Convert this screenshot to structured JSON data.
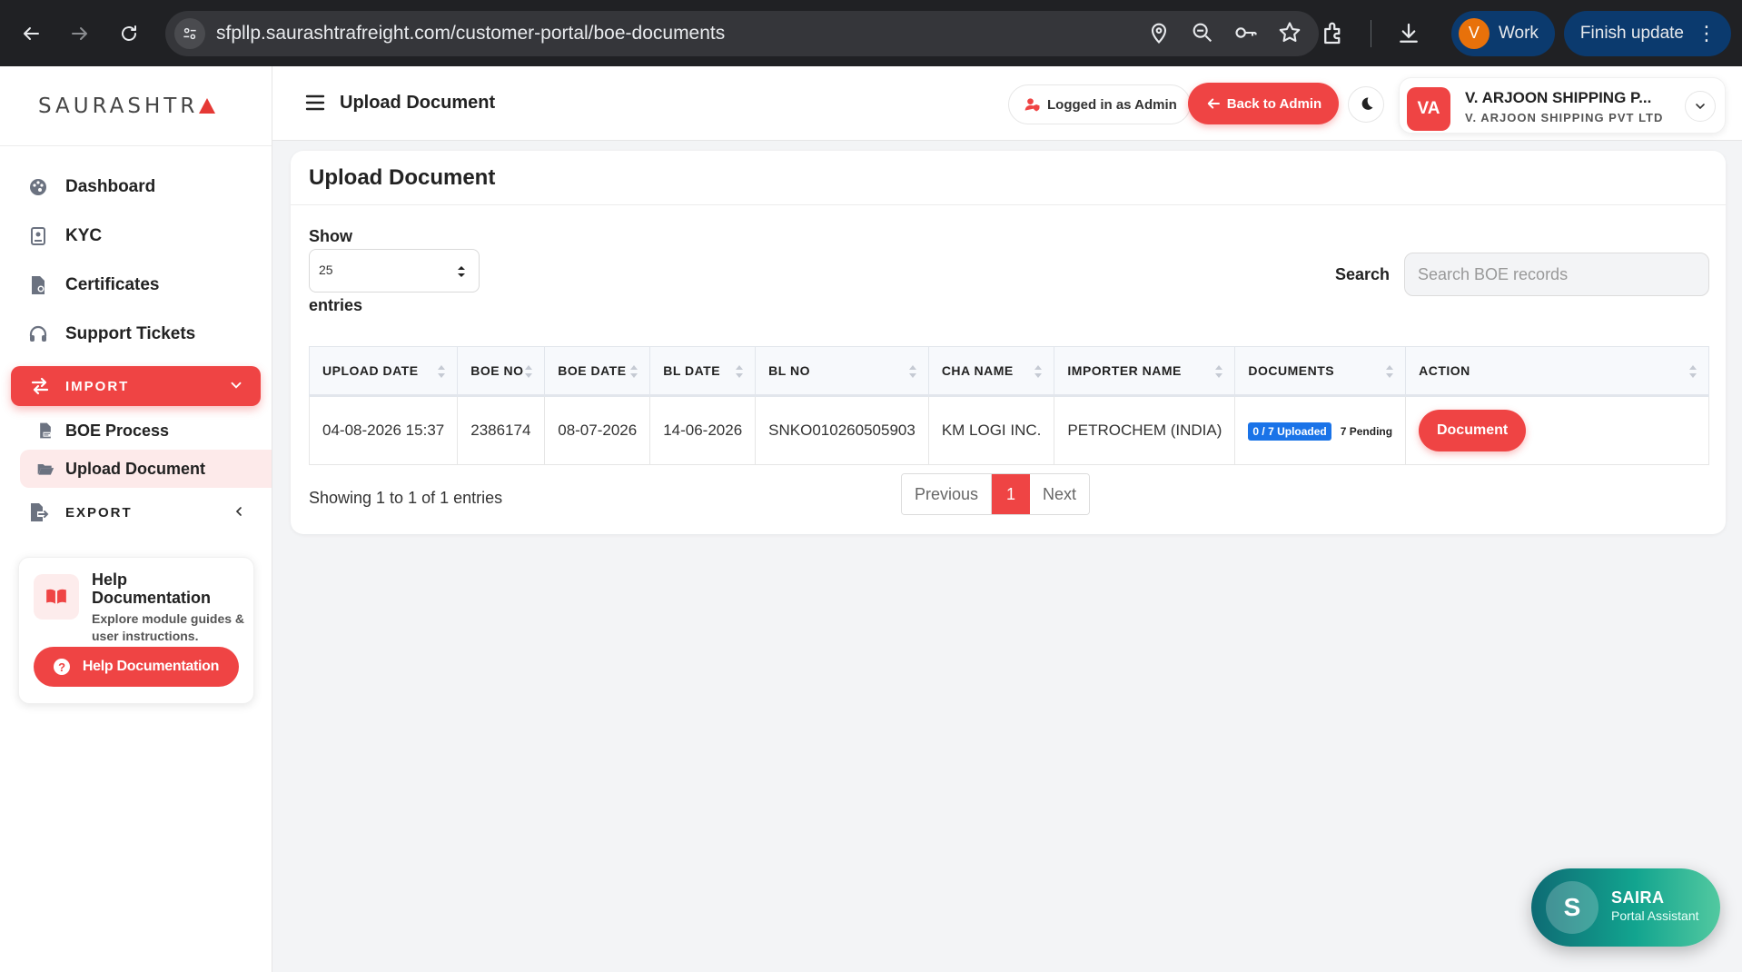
{
  "browser": {
    "url": "sfpllp.saurashtrafreight.com/customer-portal/boe-documents",
    "profile_initial": "V",
    "profile_label": "Work",
    "update_label": "Finish update"
  },
  "sidebar": {
    "brand": "SAURASHTR",
    "items": [
      {
        "label": "Dashboard",
        "icon": "palette-icon"
      },
      {
        "label": "KYC",
        "icon": "id-card-icon"
      },
      {
        "label": "Certificates",
        "icon": "certificate-file-icon"
      },
      {
        "label": "Support Tickets",
        "icon": "headset-icon"
      }
    ],
    "import_group": {
      "label": "IMPORT",
      "sub_items": [
        {
          "label": "BOE Process"
        },
        {
          "label": "Upload Document"
        }
      ]
    },
    "export_group": {
      "label": "EXPORT"
    },
    "help": {
      "title": "Help Documentation",
      "description": "Explore module guides & user instructions.",
      "button_label": "Help Documentation"
    }
  },
  "topbar": {
    "title": "Upload Document",
    "logged_in_label": "Logged in as Admin",
    "back_label": "Back to Admin",
    "account": {
      "initials": "VA",
      "name": "V. ARJOON SHIPPING P...",
      "company": "V. ARJOON SHIPPING PVT LTD"
    }
  },
  "card": {
    "title": "Upload Document",
    "show_label": "Show",
    "page_size": "25",
    "entries_label": "entries",
    "search_label": "Search",
    "search_placeholder": "Search BOE records",
    "columns": [
      "UPLOAD DATE",
      "BOE NO",
      "BOE DATE",
      "BL DATE",
      "BL NO",
      "CHA NAME",
      "IMPORTER NAME",
      "DOCUMENTS",
      "ACTION"
    ],
    "rows": [
      {
        "upload_date": "04-08-2026 15:37",
        "boe_no": "2386174",
        "boe_date": "08-07-2026",
        "bl_date": "14-06-2026",
        "bl_no": "SNKO010260505903",
        "cha_name": "KM LOGI INC.",
        "importer_name": "PETROCHEM (INDIA)",
        "uploaded_badge": "0 / 7 Uploaded",
        "pending_badge": "7 Pending",
        "action_label": "Document"
      }
    ],
    "showing_text": "Showing 1 to 1 of 1 entries",
    "pagination": {
      "previous": "Previous",
      "current": "1",
      "next": "Next"
    }
  },
  "assistant": {
    "initial": "S",
    "name": "SAIRA",
    "subtitle": "Portal Assistant"
  },
  "colors": {
    "accent": "#ef4444",
    "browser_bg": "#202124",
    "badge_blue": "#1a73e8",
    "assistant_teal": "#12a48f"
  }
}
